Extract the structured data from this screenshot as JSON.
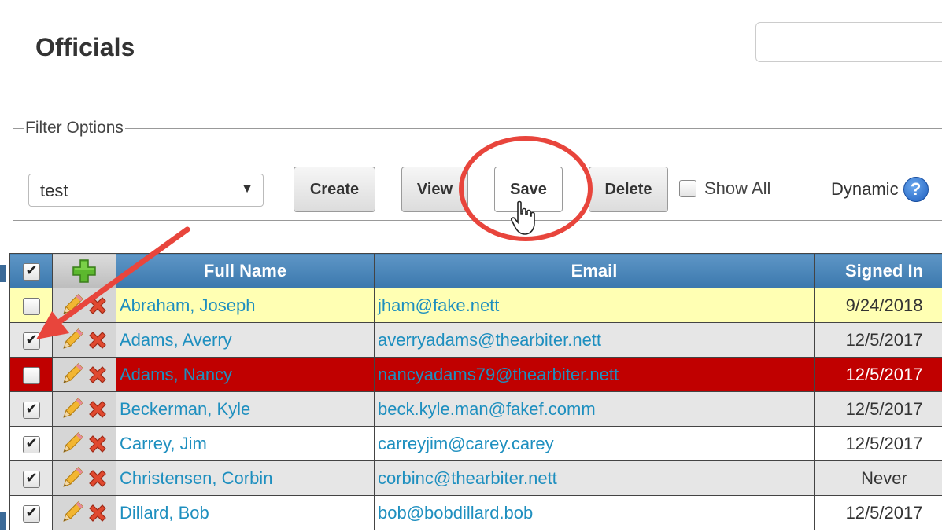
{
  "page": {
    "title": "Officials"
  },
  "filter": {
    "legend": "Filter Options",
    "selected": "test",
    "buttons": {
      "create": "Create",
      "view": "View",
      "save": "Save",
      "delete": "Delete"
    },
    "show_all_label": "Show All",
    "dynamic_label": "Dynamic",
    "help_glyph": "?"
  },
  "table": {
    "columns": {
      "full_name": "Full Name",
      "email": "Email",
      "signed_in": "Signed In"
    },
    "rows": [
      {
        "checked": false,
        "style": "yellow",
        "name": "Abraham, Joseph",
        "email": "jham@fake.nett",
        "signed_in": "9/24/2018"
      },
      {
        "checked": true,
        "style": "grey",
        "name": "Adams, Averry",
        "email": "averryadams@thearbiter.nett",
        "signed_in": "12/5/2017"
      },
      {
        "checked": false,
        "style": "red",
        "name": "Adams, Nancy",
        "email": "nancyadams79@thearbiter.nett",
        "signed_in": "12/5/2017"
      },
      {
        "checked": true,
        "style": "grey",
        "name": "Beckerman, Kyle",
        "email": "beck.kyle.man@fakef.comm",
        "signed_in": "12/5/2017"
      },
      {
        "checked": true,
        "style": "white",
        "name": "Carrey, Jim",
        "email": "carreyjim@carey.carey",
        "signed_in": "12/5/2017"
      },
      {
        "checked": true,
        "style": "grey",
        "name": "Christensen, Corbin",
        "email": "corbinc@thearbiter.nett",
        "signed_in": "Never"
      },
      {
        "checked": true,
        "style": "white",
        "name": "Dillard, Bob",
        "email": "bob@bobdillard.bob",
        "signed_in": "12/5/2017"
      }
    ]
  },
  "colors": {
    "header_blue": "#4a86b8",
    "link_blue": "#1e8fbf",
    "highlight_red": "#c00000",
    "highlight_yellow": "#ffffb3",
    "annotation_red": "#e8453c"
  },
  "icons": {
    "add": "plus-icon",
    "edit": "pencil-icon",
    "delete": "x-icon",
    "help": "help-icon",
    "cursor": "hand-cursor-icon"
  }
}
